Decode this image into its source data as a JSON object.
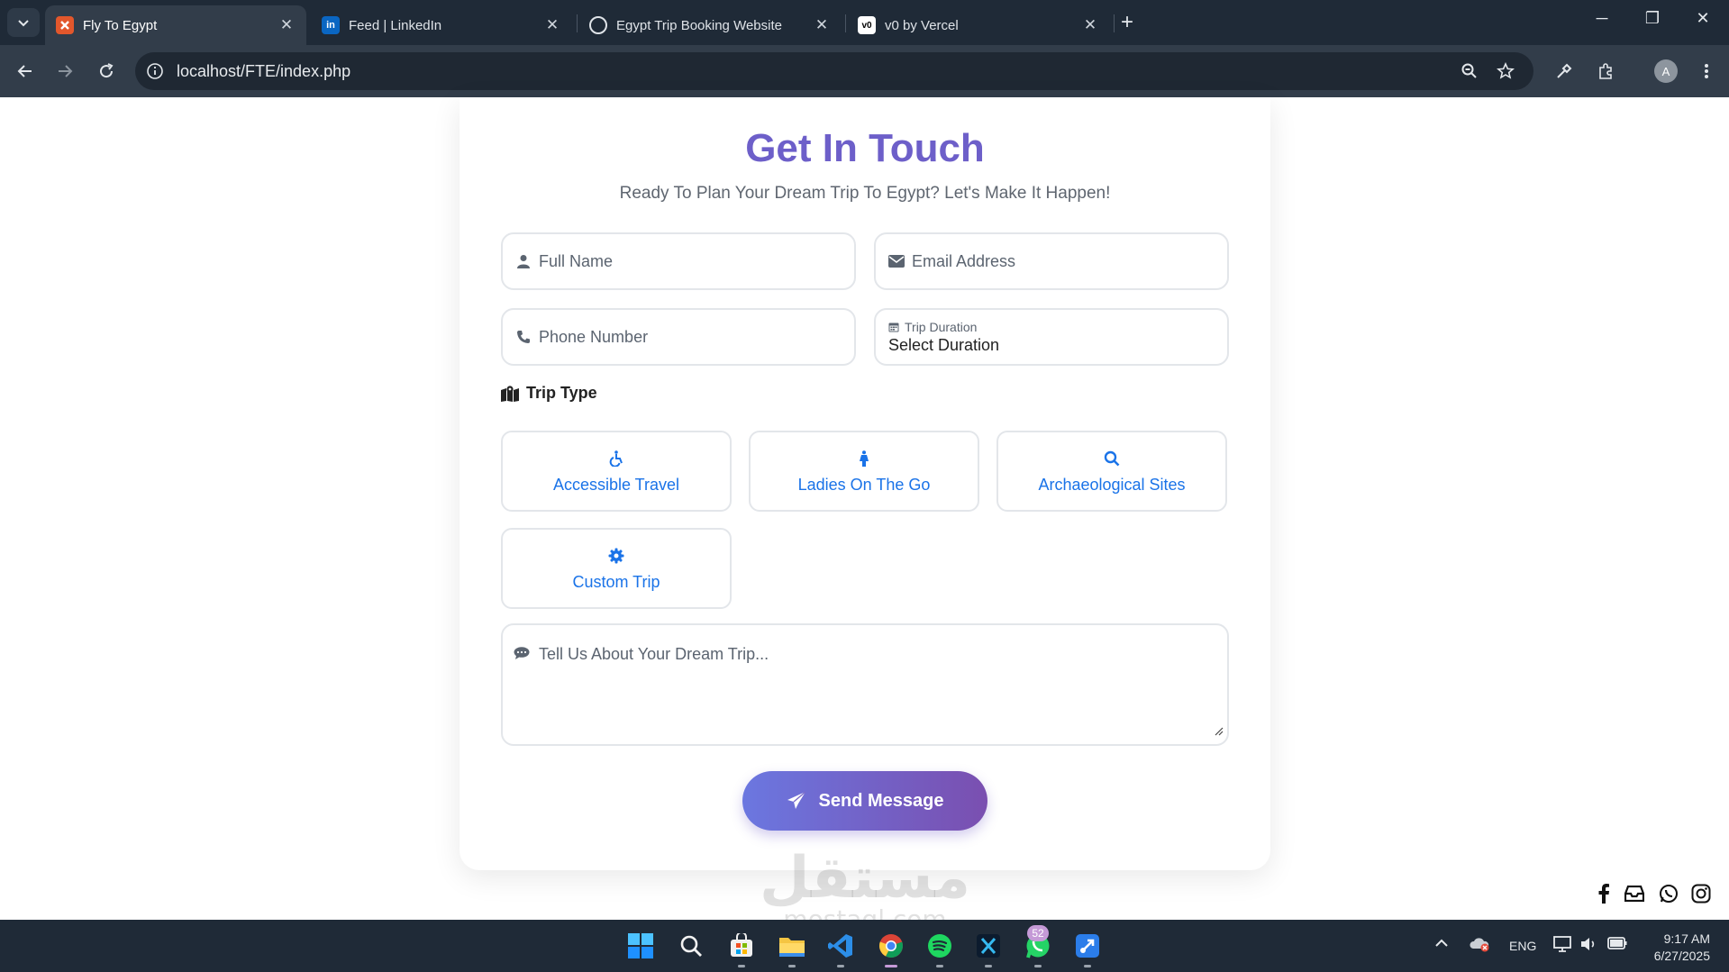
{
  "browser": {
    "tabs": [
      {
        "title": "Fly To Egypt",
        "active": true,
        "favicon": "xampp-icon"
      },
      {
        "title": "Feed | LinkedIn",
        "active": false,
        "favicon": "linkedin-icon"
      },
      {
        "title": "Egypt Trip Booking Website",
        "active": false,
        "favicon": "chatgpt-icon"
      },
      {
        "title": "v0 by Vercel",
        "active": false,
        "favicon": "v0-icon"
      }
    ],
    "url": "localhost/FTE/index.php",
    "profile_initial": "A"
  },
  "contact": {
    "title": "Get In Touch",
    "subtitle": "Ready To Plan Your Dream Trip To Egypt? Let's Make It Happen!",
    "full_name_placeholder": "Full Name",
    "email_placeholder": "Email Address",
    "phone_placeholder": "Phone Number",
    "duration_label": "Trip Duration",
    "duration_value": "Select Duration",
    "trip_type_title": "Trip Type",
    "trip_types": [
      {
        "label": "Accessible Travel",
        "icon": "wheelchair-icon"
      },
      {
        "label": "Ladies On The Go",
        "icon": "female-icon"
      },
      {
        "label": "Archaeological Sites",
        "icon": "search-icon"
      },
      {
        "label": "Custom Trip",
        "icon": "gear-icon"
      }
    ],
    "message_placeholder": "Tell Us About Your Dream Trip...",
    "send_label": "Send Message"
  },
  "social": [
    "facebook-icon",
    "inbox-icon",
    "whatsapp-icon",
    "instagram-icon"
  ],
  "watermark": {
    "arabic": "مستقل",
    "latin": "mostaql.com"
  },
  "taskbar": {
    "whatsapp_badge": "52",
    "language": "ENG",
    "time": "9:17 AM",
    "date": "6/27/2025"
  },
  "colors": {
    "accent": "#6d5fc9",
    "link": "#1a73e8",
    "button_start": "#6b77e0",
    "button_end": "#7a4fb0"
  }
}
